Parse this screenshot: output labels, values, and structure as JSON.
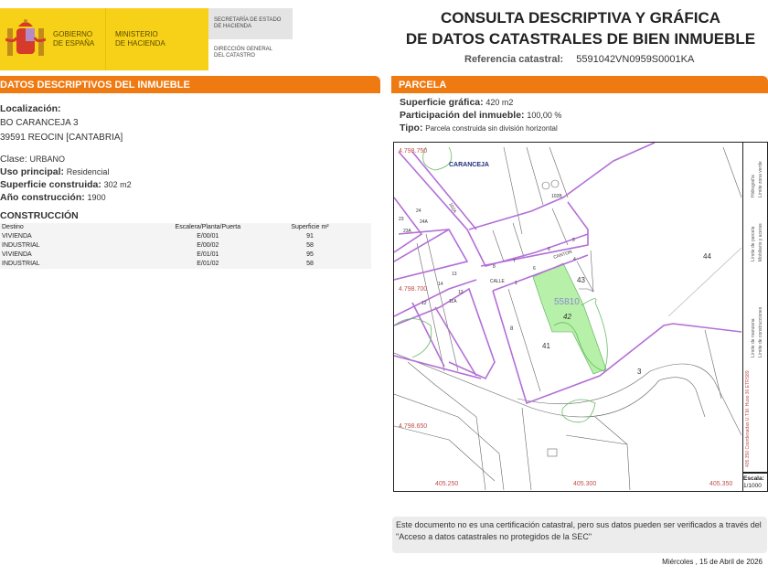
{
  "header": {
    "gov_line1": "GOBIERNO",
    "gov_line2": "DE ESPAÑA",
    "min_line1": "MINISTERIO",
    "min_line2": "DE HACIENDA",
    "sec_line1": "SECRETARÍA DE ESTADO",
    "sec_line2": "DE HACIENDA",
    "dir_line1": "DIRECCIÓN GENERAL",
    "dir_line2": "DEL CATASTRO",
    "title_line1": "CONSULTA DESCRIPTIVA Y GRÁFICA",
    "title_line2": "DE DATOS CATASTRALES DE BIEN INMUEBLE",
    "ref_label": "Referencia catastral:",
    "ref_value": "5591042VN0959S0001KA"
  },
  "datos": {
    "section_title": "DATOS DESCRIPTIVOS DEL INMUEBLE",
    "localizacion_label": "Localización:",
    "address1": "BO CARANCEJA 3",
    "address2": "39591 REOCIN [CANTABRIA]",
    "clase_label": "Clase:",
    "clase_value": "URBANO",
    "uso_label": "Uso principal:",
    "uso_value": "Residencial",
    "superficie_label": "Superficie construida:",
    "superficie_value": "302 m2",
    "anio_label": "Año construcción:",
    "anio_value": "1900",
    "construccion_title": "CONSTRUCCIÓN",
    "columns": [
      "Destino",
      "Escalera/Planta/Puerta",
      "Superficie m²"
    ],
    "rows": [
      [
        "VIVIENDA",
        "E/00/01",
        "91"
      ],
      [
        "INDUSTRIAL",
        "E/00/02",
        "58"
      ],
      [
        "VIVIENDA",
        "E/01/01",
        "95"
      ],
      [
        "INDUSTRIAL",
        "E/01/02",
        "58"
      ]
    ]
  },
  "parcela": {
    "section_title": "PARCELA",
    "sup_label": "Superficie gráfica:",
    "sup_value": "420 m2",
    "part_label": "Participación del inmueble:",
    "part_value": "100,00 %",
    "tipo_label": "Tipo:",
    "tipo_value": "Parcela construida sin división horizontal"
  },
  "map": {
    "place": "CARANCEJA",
    "parcel_id": "55810",
    "y_coords": [
      "4.798.750",
      "4.798.700",
      "4.798.650"
    ],
    "x_coords": [
      "405.250",
      "405.300",
      "405.350"
    ],
    "street1": "CALLE",
    "street2": "CANTON",
    "numbers": [
      "41",
      "42",
      "43",
      "44",
      "3",
      "8",
      "1",
      "6",
      "7",
      "5",
      "4",
      "8",
      "11",
      "11A",
      "12",
      "13",
      "14",
      "23",
      "24",
      "23A",
      "24A",
      "102B",
      "102A"
    ],
    "parcel_color": "#b7f0a8",
    "boundary_color": "#b36fd6"
  },
  "legend": {
    "coords": "405.350 Coordenadas U.T.M. Huso 30 ETRS89",
    "items": [
      "Límite de manzana",
      "Límite de construcciones",
      "Límite de parcela",
      "Mobiliario y aceras",
      "Hidrografía",
      "Límite zona verde"
    ],
    "scale_label": "Escala:",
    "scale_value": "1/1000"
  },
  "footer": {
    "notice": "Este documento no es una certificación catastral, pero sus datos pueden ser verificados a través del \"Acceso a datos catastrales no protegidos de la SEC\"",
    "date": "Miércoles , 15 de Abril de 2026"
  }
}
